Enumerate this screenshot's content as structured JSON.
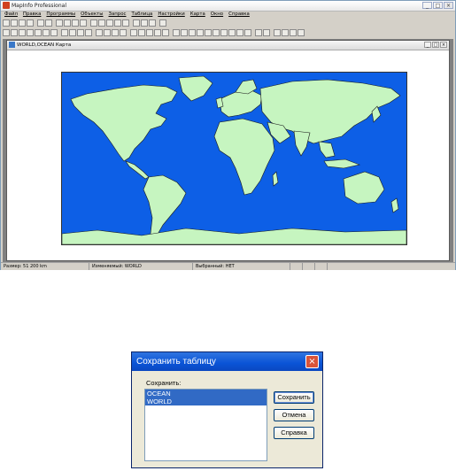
{
  "app": {
    "title": "MapInfo Professional",
    "window_buttons": [
      "_",
      "□",
      "×"
    ]
  },
  "menu": [
    "Файл",
    "Правка",
    "Программы",
    "Объекты",
    "Запрос",
    "Таблица",
    "Настройки",
    "Карта",
    "Окно",
    "Справка"
  ],
  "map_window": {
    "title": "WORLD,OCEAN Карта",
    "colors": {
      "ocean": "#0d5fe6",
      "land": "#c6f5c0"
    }
  },
  "status_bar": {
    "size": "Размер: 51 200 km",
    "editable": "Изменяемый: WORLD",
    "selectable": "Выбранный: НЕТ"
  },
  "dialog": {
    "title": "Сохранить таблицу",
    "label": "Сохранить:",
    "items": [
      "OCEAN",
      "WORLD"
    ],
    "buttons": {
      "save": "Сохранить",
      "cancel": "Отмена",
      "help": "Справка"
    },
    "close_glyph": "×"
  }
}
